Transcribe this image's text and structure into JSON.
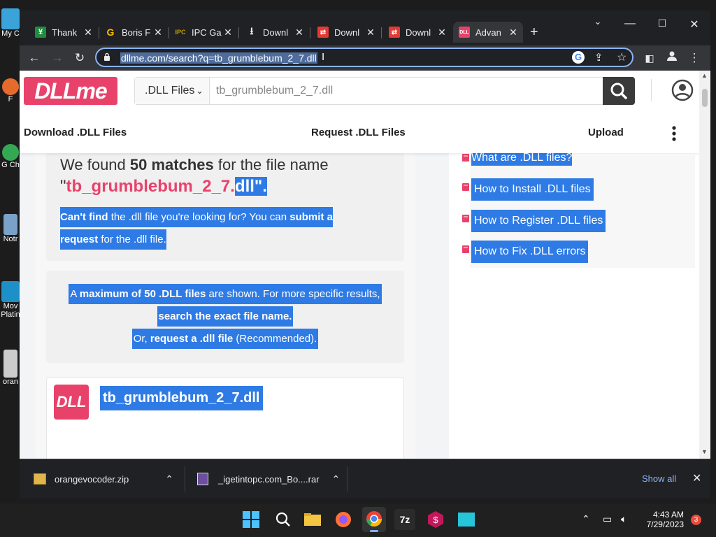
{
  "desktop": {
    "icons": [
      {
        "label": "My C",
        "color": "#3aa3d9"
      },
      {
        "label": "F",
        "color": "#e66a2c"
      },
      {
        "label": "G Ch",
        "color": "#34a853"
      },
      {
        "label": "Notr",
        "color": "#7aa2c8"
      },
      {
        "label": "Mov Platin",
        "color": "#1e90c8"
      },
      {
        "label": "oran",
        "color": "#cccccc"
      }
    ]
  },
  "browser": {
    "tabs": [
      {
        "title": "Thank",
        "icon": "spreadsheet-icon",
        "icon_color": "#1e8e3e"
      },
      {
        "title": "Boris F",
        "icon": "google-g-icon",
        "icon_color": "#fbbc04"
      },
      {
        "title": "IPC Ga",
        "icon": "ipc-games-icon",
        "icon_color": "#c8a000"
      },
      {
        "title": "Downl",
        "icon": "download-icon",
        "icon_color": "#e8eaed"
      },
      {
        "title": "Downl",
        "icon": "red-site-icon",
        "icon_color": "#e53935"
      },
      {
        "title": "Downl",
        "icon": "red-site-icon",
        "icon_color": "#e53935"
      },
      {
        "title": "Advan",
        "icon": "dll-icon",
        "icon_color": "#e8426b"
      }
    ],
    "new_tab_glyph": "+",
    "url": "dllme.com/search?q=tb_grumblebum_2_7.dll"
  },
  "site": {
    "logo": "DLLme",
    "search_select": ".DLL Files",
    "search_placeholder": "tb_grumblebum_2_7.dll",
    "nav": {
      "download": "Download .DLL Files",
      "request": "Request .DLL Files",
      "upload": "Upload"
    },
    "result_heading": {
      "pre": "We found ",
      "bold": "50 matches",
      "post": " for the file name",
      "quote_open": "\"",
      "file_pink": "tb_grumblebum_2_7.",
      "file_sel": "dll\"."
    },
    "cant_find": {
      "b1": "Can't find",
      "t1": " the .dll file you're looking for? You can ",
      "b2": "submit a",
      "b3": "request",
      "t2": " for the .dll file."
    },
    "maximum": {
      "t1": "A ",
      "b1": "maximum of 50 .DLL files",
      "t2": " are shown. For more specific results,",
      "b2": "search the exact file name.",
      "t3": "Or, ",
      "b3": "request a .dll file",
      "t4": " (Recommended)."
    },
    "result_card": {
      "logo": "DLL",
      "name": "tb_grumblebum_2_7.dll"
    },
    "sidebar": [
      "What are .DLL files?",
      "How to Install .DLL files",
      "How to Register .DLL files",
      "How to Fix .DLL errors"
    ]
  },
  "downloads": {
    "items": [
      {
        "name": "orangevocoder.zip"
      },
      {
        "name": "_igetintopc.com_Bo....rar"
      }
    ],
    "show_all": "Show all"
  },
  "taskbar": {
    "time": "4:43 AM",
    "date": "7/29/2023",
    "notifications": "3"
  },
  "colors": {
    "accent": "#e8426b",
    "selection": "#2f7be5"
  }
}
